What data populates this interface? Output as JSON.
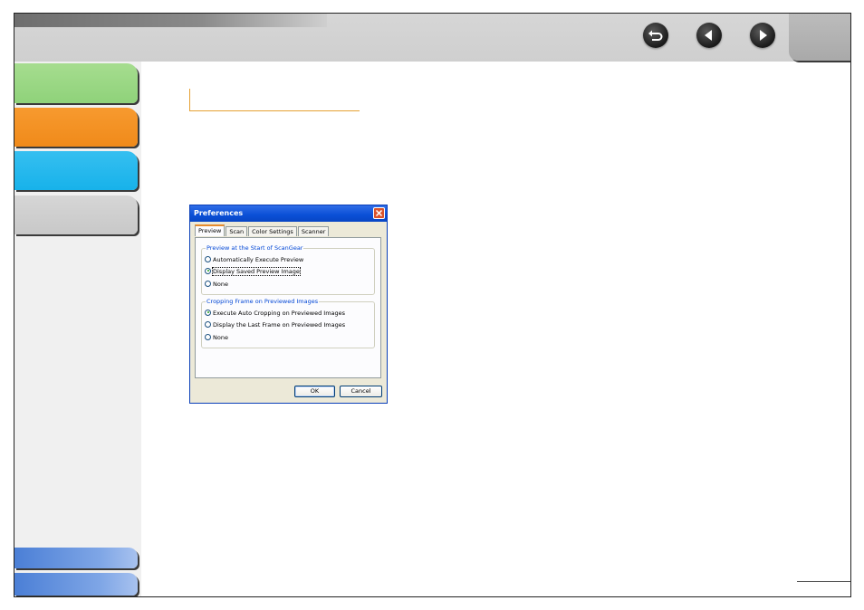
{
  "nav": {
    "icons": [
      "back-icon",
      "previous-page-icon",
      "next-page-icon"
    ]
  },
  "dialog": {
    "title": "Preferences",
    "tabs": [
      {
        "label": "Preview",
        "active": true
      },
      {
        "label": "Scan",
        "active": false
      },
      {
        "label": "Color Settings",
        "active": false
      },
      {
        "label": "Scanner",
        "active": false
      }
    ],
    "group1": {
      "legend": "Preview at the Start of ScanGear",
      "options": [
        {
          "label": "Automatically Execute Preview",
          "selected": false
        },
        {
          "label": "Display Saved Preview Image",
          "selected": true
        },
        {
          "label": "None",
          "selected": false
        }
      ]
    },
    "group2": {
      "legend": "Cropping Frame on Previewed Images",
      "options": [
        {
          "label": "Execute Auto Cropping on Previewed Images",
          "selected": true
        },
        {
          "label": "Display the Last Frame on Previewed Images",
          "selected": false
        },
        {
          "label": "None",
          "selected": false
        }
      ]
    },
    "ok_label": "OK",
    "cancel_label": "Cancel"
  },
  "colors": {
    "sidebar_green": "#8fd27a",
    "sidebar_orange": "#f08a1a",
    "sidebar_cyan": "#17b2ea",
    "sidebar_gray": "#c8c8c8",
    "sidebar_blue": "#4b7fd6",
    "heading_rule": "#e5a133",
    "xp_title": "#0a4fd6"
  }
}
